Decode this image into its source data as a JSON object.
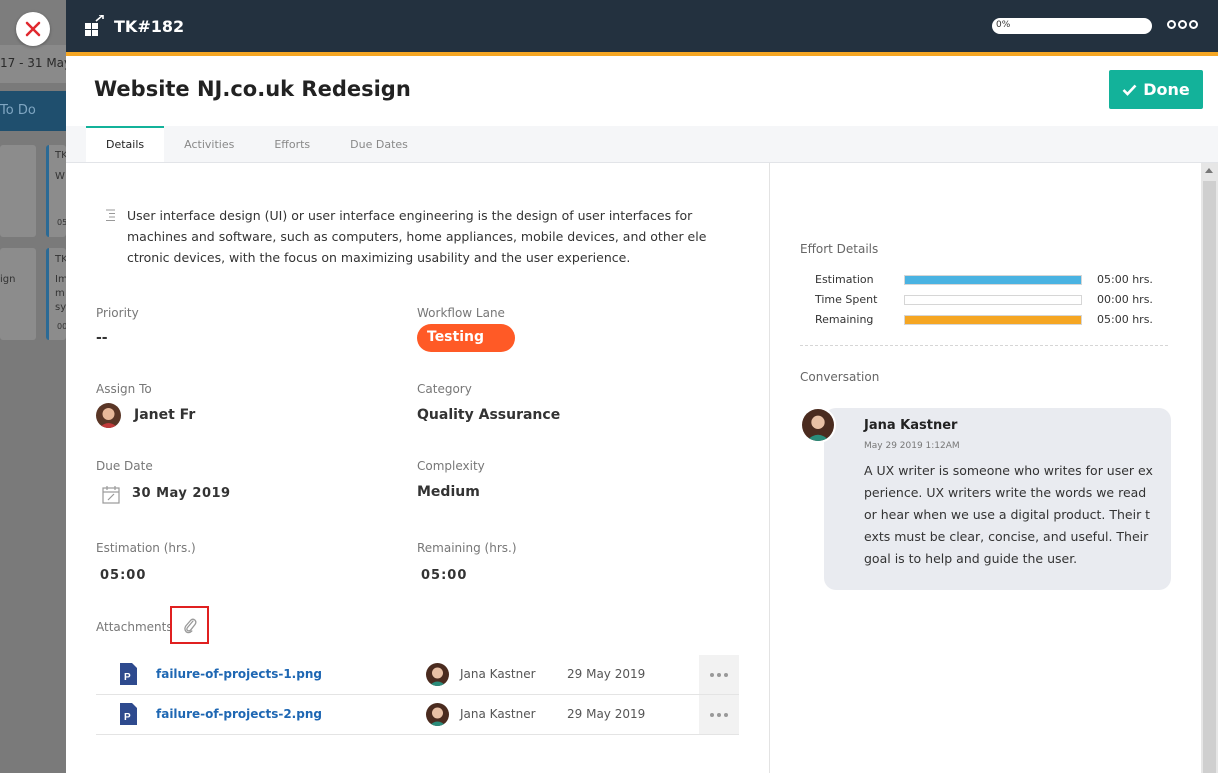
{
  "background": {
    "date_range": "17 - 31 May",
    "lane": "To Do",
    "snippets": [
      "TK",
      "W",
      "TK",
      "Im",
      "m",
      "sy",
      "ign",
      "05",
      "00"
    ]
  },
  "header": {
    "task_id": "TK#182",
    "progress": "0%",
    "progress_value": 0,
    "accent_color": "#f5a623",
    "bar_color": "#23313f"
  },
  "task": {
    "title": "Website NJ.co.uk Redesign",
    "done_label": "Done",
    "done_color": "#13b29a"
  },
  "tabs": [
    {
      "label": "Details",
      "active": true
    },
    {
      "label": "Activities",
      "active": false
    },
    {
      "label": "Efforts",
      "active": false
    },
    {
      "label": "Due Dates",
      "active": false
    }
  ],
  "description": "User interface design (UI) or user interface engineering is the design of user interfaces for machines and software, such as computers, home appliances, mobile devices, and other electronic devices, with the focus on maximizing usability and the user experience.",
  "fields": {
    "priority_label": "Priority",
    "priority_value": "--",
    "workflow_label": "Workflow Lane",
    "workflow_value": "Testing",
    "workflow_color": "#ff5a26",
    "assign_label": "Assign To",
    "assign_value": "Janet Fr",
    "category_label": "Category",
    "category_value": "Quality Assurance",
    "due_label": "Due Date",
    "due_value": "30 May 2019",
    "complexity_label": "Complexity",
    "complexity_value": "Medium",
    "estimation_label": "Estimation (hrs.)",
    "estimation_value": "05:00",
    "remaining_label": "Remaining (hrs.)",
    "remaining_value": "05:00"
  },
  "attachments": {
    "label": "Attachments",
    "files": [
      {
        "name": "failure-of-projects-1.png",
        "user": "Jana Kastner",
        "date": "29 May 2019"
      },
      {
        "name": "failure-of-projects-2.png",
        "user": "Jana Kastner",
        "date": "29 May 2019"
      }
    ]
  },
  "effort": {
    "title": "Effort Details",
    "rows": [
      {
        "label": "Estimation",
        "value": "05:00 hrs.",
        "fill": 1.0,
        "color": "#4ab3e2"
      },
      {
        "label": "Time Spent",
        "value": "00:00 hrs.",
        "fill": 0.0,
        "color": "#4ab3e2"
      },
      {
        "label": "Remaining",
        "value": "05:00 hrs.",
        "fill": 1.0,
        "color": "#f5a623"
      }
    ]
  },
  "conversation": {
    "title": "Conversation",
    "author": "Jana Kastner",
    "time": "May 29 2019 1:12AM",
    "text": "A UX writer is someone who writes for user experience. UX writers write the words we read or hear when we use a digital product. Their texts must be clear, concise, and useful. Their goal is to help and guide the user."
  }
}
